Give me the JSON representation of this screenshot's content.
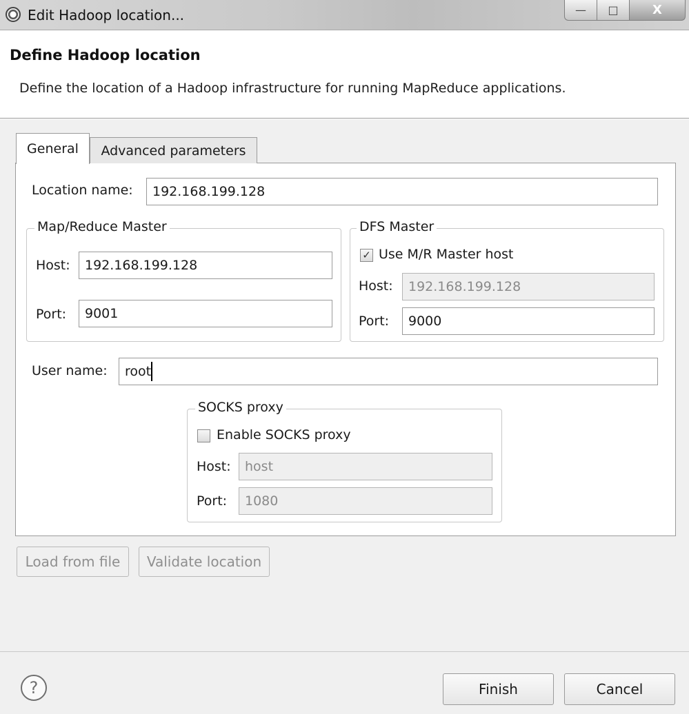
{
  "window": {
    "title": "Edit Hadoop location...",
    "min_icon": "—",
    "max_icon": "□",
    "close_icon": "X"
  },
  "header": {
    "title": "Define Hadoop location",
    "description": "Define the location of a Hadoop infrastructure for running MapReduce applications."
  },
  "tabs": [
    {
      "label": "General",
      "selected": true
    },
    {
      "label": "Advanced parameters",
      "selected": false
    }
  ],
  "general": {
    "location_name_label": "Location name:",
    "location_name_value": "192.168.199.128",
    "mr_master": {
      "legend": "Map/Reduce Master",
      "host_label": "Host:",
      "host_value": "192.168.199.128",
      "port_label": "Port:",
      "port_value": "9001"
    },
    "dfs_master": {
      "legend": "DFS Master",
      "use_mr_host_label": "Use M/R Master host",
      "use_mr_host_checked": true,
      "check_mark": "✓",
      "host_label": "Host:",
      "host_value": "192.168.199.128",
      "port_label": "Port:",
      "port_value": "9000"
    },
    "user_name_label": "User name:",
    "user_name_value": "root",
    "socks": {
      "legend": "SOCKS proxy",
      "enable_label": "Enable SOCKS proxy",
      "enable_checked": false,
      "host_label": "Host:",
      "host_value": "host",
      "port_label": "Port:",
      "port_value": "1080"
    }
  },
  "actions": {
    "load_from_file": "Load from file",
    "validate_location": "Validate location"
  },
  "footer": {
    "help_glyph": "?",
    "finish": "Finish",
    "cancel": "Cancel"
  }
}
